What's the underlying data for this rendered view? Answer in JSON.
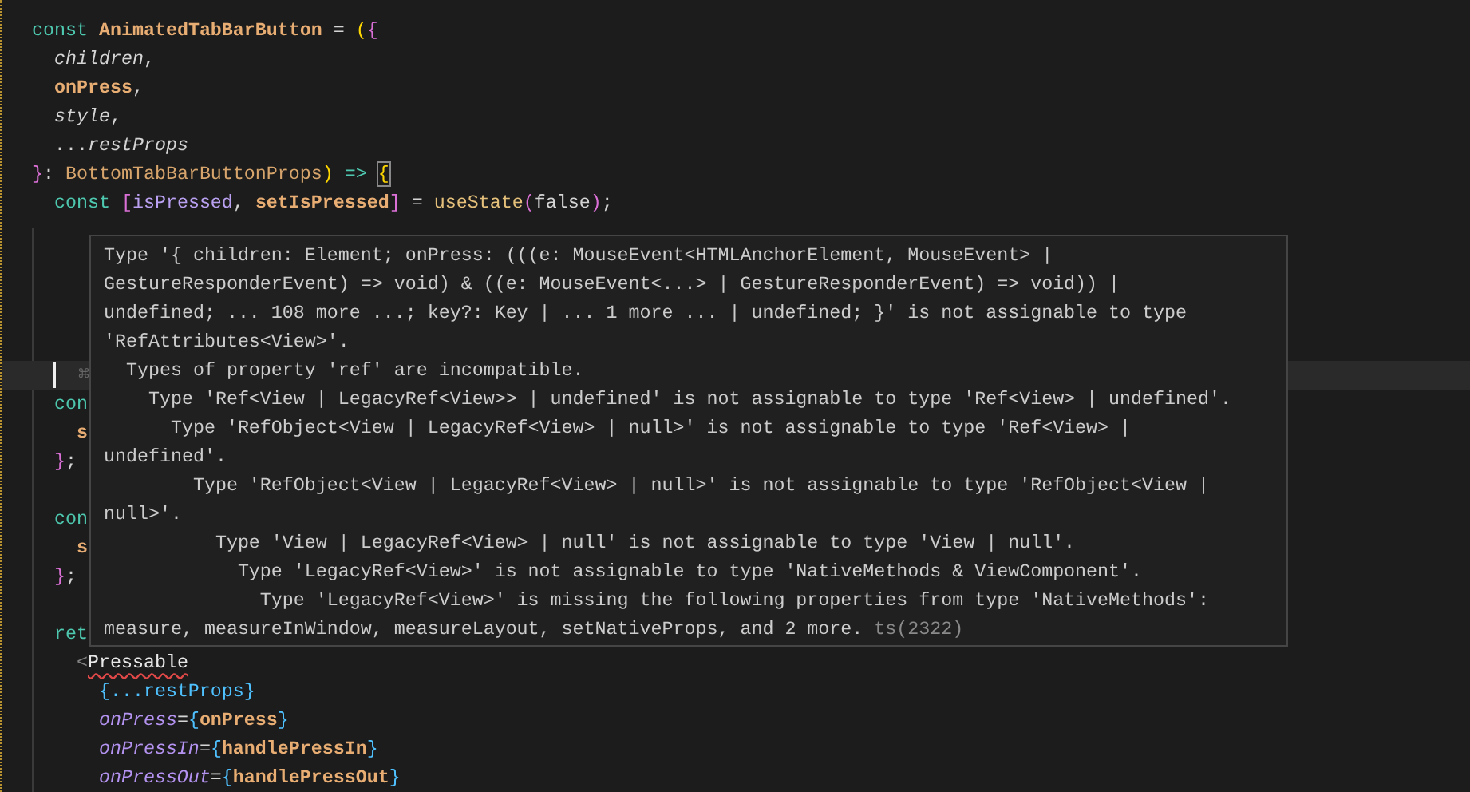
{
  "editor": {
    "lines": [
      {
        "current": false,
        "tokens": [
          {
            "text": "const ",
            "kind": "keyword"
          },
          {
            "text": "AnimatedTabBarButton",
            "kind": "function"
          },
          {
            "text": " = ",
            "kind": "plain"
          },
          {
            "text": "(",
            "kind": "bracket1"
          },
          {
            "text": "{",
            "kind": "bracket2"
          }
        ]
      },
      {
        "current": false,
        "tokens": [
          {
            "text": "  children",
            "kind": "param"
          },
          {
            "text": ",",
            "kind": "plain"
          }
        ]
      },
      {
        "current": false,
        "tokens": [
          {
            "text": "  onPress",
            "kind": "param-bold"
          },
          {
            "text": ",",
            "kind": "plain"
          }
        ]
      },
      {
        "current": false,
        "tokens": [
          {
            "text": "  style",
            "kind": "param"
          },
          {
            "text": ",",
            "kind": "plain"
          }
        ]
      },
      {
        "current": false,
        "tokens": [
          {
            "text": "  ...",
            "kind": "plain"
          },
          {
            "text": "restProps",
            "kind": "param"
          }
        ]
      },
      {
        "current": false,
        "tokens": [
          {
            "text": "}",
            "kind": "bracket2"
          },
          {
            "text": ": ",
            "kind": "plain"
          },
          {
            "text": "BottomTabBarButtonProps",
            "kind": "type"
          },
          {
            "text": ")",
            "kind": "bracket1"
          },
          {
            "text": " => ",
            "kind": "keyword"
          },
          {
            "text": "{",
            "kind": "bracket1-boxed"
          }
        ]
      },
      {
        "current": false,
        "tokens": [
          {
            "text": "  const ",
            "kind": "keyword"
          },
          {
            "text": "[",
            "kind": "bracket2"
          },
          {
            "text": "isPressed",
            "kind": "variable"
          },
          {
            "text": ", ",
            "kind": "plain"
          },
          {
            "text": "setIsPressed",
            "kind": "param-bold"
          },
          {
            "text": "]",
            "kind": "bracket2"
          },
          {
            "text": " = ",
            "kind": "plain"
          },
          {
            "text": "useState",
            "kind": "call"
          },
          {
            "text": "(",
            "kind": "bracket2"
          },
          {
            "text": "false",
            "kind": "plain"
          },
          {
            "text": ")",
            "kind": "bracket2"
          },
          {
            "text": ";",
            "kind": "plain"
          }
        ]
      },
      {
        "current": false
      },
      {
        "current": false
      },
      {
        "current": false
      },
      {
        "current": false
      },
      {
        "current": false
      },
      {
        "current": true,
        "tokens": [
          {
            "text": "⌘",
            "kind": "hint"
          }
        ]
      },
      {
        "current": false,
        "tokens": [
          {
            "text": "  con",
            "kind": "keyword"
          }
        ]
      },
      {
        "current": false,
        "tokens": [
          {
            "text": "    s",
            "kind": "function"
          }
        ]
      },
      {
        "current": false,
        "tokens": [
          {
            "text": "  }",
            "kind": "bracket2"
          },
          {
            "text": ";",
            "kind": "plain"
          }
        ]
      },
      {
        "current": false
      },
      {
        "current": false,
        "tokens": [
          {
            "text": "  con",
            "kind": "keyword"
          }
        ]
      },
      {
        "current": false,
        "tokens": [
          {
            "text": "    s",
            "kind": "function"
          }
        ]
      },
      {
        "current": false,
        "tokens": [
          {
            "text": "  }",
            "kind": "bracket2"
          },
          {
            "text": ";",
            "kind": "plain"
          }
        ]
      },
      {
        "current": false
      },
      {
        "current": false,
        "tokens": [
          {
            "text": "  ret",
            "kind": "keyword"
          }
        ]
      },
      {
        "current": false,
        "tokens": [
          {
            "text": "    <",
            "kind": "muted"
          },
          {
            "text": "Pressable",
            "kind": "tag-error"
          }
        ]
      },
      {
        "current": false,
        "tokens": [
          {
            "text": "      {",
            "kind": "bracket3"
          },
          {
            "text": "...restProps",
            "kind": "bracket3"
          },
          {
            "text": "}",
            "kind": "bracket3"
          }
        ]
      },
      {
        "current": false,
        "tokens": [
          {
            "text": "      onPress",
            "kind": "attr"
          },
          {
            "text": "=",
            "kind": "plain"
          },
          {
            "text": "{",
            "kind": "bracket3"
          },
          {
            "text": "onPress",
            "kind": "function"
          },
          {
            "text": "}",
            "kind": "bracket3"
          }
        ]
      },
      {
        "current": false,
        "tokens": [
          {
            "text": "      onPressIn",
            "kind": "attr"
          },
          {
            "text": "=",
            "kind": "plain"
          },
          {
            "text": "{",
            "kind": "bracket3"
          },
          {
            "text": "handlePressIn",
            "kind": "function"
          },
          {
            "text": "}",
            "kind": "bracket3"
          }
        ]
      },
      {
        "current": false,
        "tokens": [
          {
            "text": "      onPressOut",
            "kind": "attr"
          },
          {
            "text": "=",
            "kind": "plain"
          },
          {
            "text": "{",
            "kind": "bracket3"
          },
          {
            "text": "handlePressOut",
            "kind": "function"
          },
          {
            "text": "}",
            "kind": "bracket3"
          }
        ]
      }
    ]
  },
  "tooltip": {
    "lines": [
      {
        "text": "Type '{ children: Element; onPress: (((e: MouseEvent<HTMLAnchorElement, MouseEvent> |"
      },
      {
        "text": "GestureResponderEvent) => void) & ((e: MouseEvent<...> | GestureResponderEvent) => void)) |"
      },
      {
        "text": "undefined; ... 108 more ...; key?: Key | ... 1 more ... | undefined; }' is not assignable to type"
      },
      {
        "text": "'RefAttributes<View>'."
      },
      {
        "text": "  Types of property 'ref' are incompatible."
      },
      {
        "text": "    Type 'Ref<View | LegacyRef<View>> | undefined' is not assignable to type 'Ref<View> | undefined'."
      },
      {
        "text": "      Type 'RefObject<View | LegacyRef<View> | null>' is not assignable to type 'Ref<View> |"
      },
      {
        "text": "undefined'."
      },
      {
        "text": "        Type 'RefObject<View | LegacyRef<View> | null>' is not assignable to type 'RefObject<View |"
      },
      {
        "text": "null>'."
      },
      {
        "text": "          Type 'View | LegacyRef<View> | null' is not assignable to type 'View | null'."
      },
      {
        "text": "            Type 'LegacyRef<View>' is not assignable to type 'NativeMethods & ViewComponent'."
      },
      {
        "text": "              Type 'LegacyRef<View>' is missing the following properties from type 'NativeMethods':"
      },
      {
        "text": "measure, measureInWindow, measureLayout, setNativeProps, and 2 more. ",
        "source": "ts(2322)"
      }
    ]
  }
}
